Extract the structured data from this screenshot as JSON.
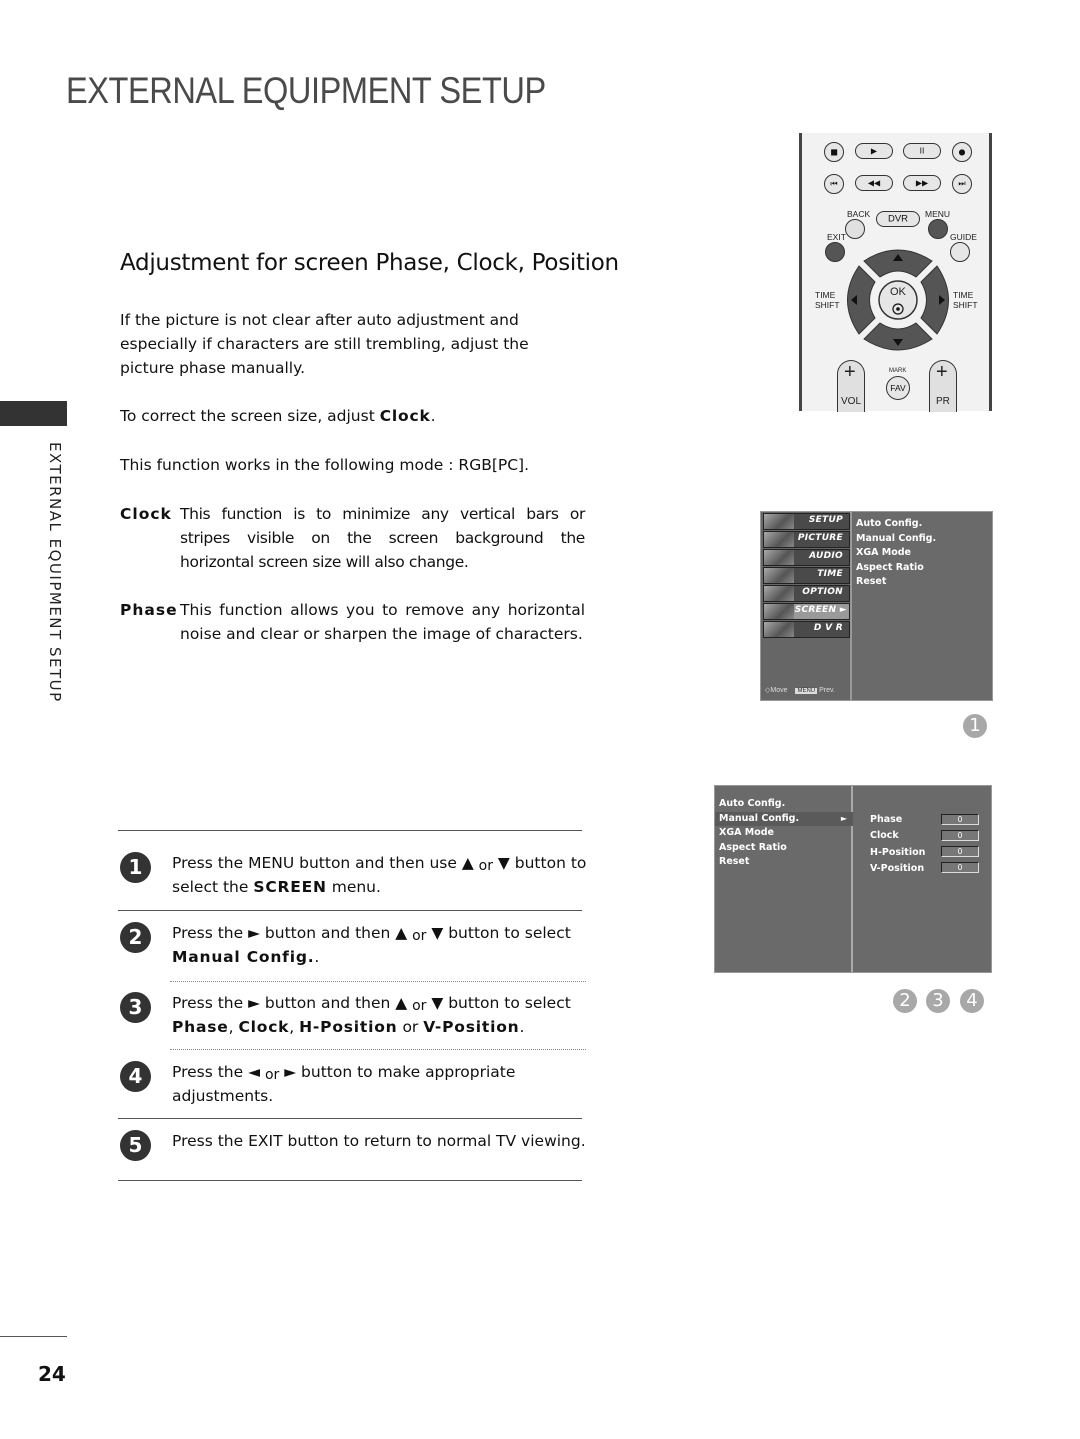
{
  "header": {
    "title": "EXTERNAL EQUIPMENT SETUP"
  },
  "side_label": "EXTERNAL EQUIPMENT SETUP",
  "section": {
    "title": "Adjustment for screen Phase, Clock, Position"
  },
  "intro": {
    "p1": "If the picture is not clear after auto adjustment and especially if characters are still trembling, adjust the picture phase manually.",
    "p2_prefix": "To correct the screen size, adjust ",
    "p2_bold": "Clock",
    "p2_suffix": ".",
    "p3": "This function works in the following mode : RGB[PC]."
  },
  "definitions": [
    {
      "term": "Clock",
      "text": "This function is to minimize any vertical bars or stripes visible on the screen background the horizontal screen size will also change."
    },
    {
      "term": "Phase",
      "text": "This function allows you to remove any horizontal noise and clear or sharpen the image of characters."
    }
  ],
  "steps": [
    {
      "num": "1",
      "a": "Press the ",
      "b1": "MENU",
      "c": " button and then use ▲ ",
      "or": "or",
      "d": " ▼ button to select the ",
      "b2": "SCREEN",
      "e": " menu."
    },
    {
      "num": "2",
      "a": "Press the ► button and then ▲ ",
      "or": "or",
      "d": " ▼ button to select ",
      "b1": "Manual Config.",
      "e": "."
    },
    {
      "num": "3",
      "a": "Press the ► button and then ▲ ",
      "or": "or",
      "d": " ▼ button to select ",
      "b1": "Phase",
      "s1": ", ",
      "b2": "Clock",
      "s2": ", ",
      "b3": "H-Position",
      "s3": " or ",
      "b4": "V-Position",
      "e": "."
    },
    {
      "num": "4",
      "a": "Press the ◄ ",
      "or": "or",
      "d": " ► button to make appropriate adjustments."
    },
    {
      "num": "5",
      "a": "Press the ",
      "b1": "EXIT",
      "e": " button to return to normal TV viewing."
    }
  ],
  "remote": {
    "glyphs": {
      "stop": "■",
      "play": "▶",
      "pause": "II",
      "rec": "●",
      "prev": "⏮",
      "rew": "◀◀",
      "ff": "▶▶",
      "next": "⏭"
    },
    "labels": {
      "back": "BACK",
      "dvr": "DVR",
      "menu": "MENU",
      "exit": "EXIT",
      "guide": "GUIDE",
      "timeshift_l1": "TIME",
      "timeshift_l2": "SHIFT",
      "timeshift_r1": "TIME",
      "timeshift_r2": "SHIFT",
      "ok": "OK",
      "mark": "MARK",
      "fav": "FAV",
      "vol": "VOL",
      "pr": "PR",
      "plus": "+",
      "up": "▲",
      "down": "▼",
      "left": "◀",
      "right": "▶",
      "ok_dot": "⊙"
    }
  },
  "osd1": {
    "menu": [
      {
        "label": "SETUP",
        "active": false
      },
      {
        "label": "PICTURE",
        "active": false
      },
      {
        "label": "AUDIO",
        "active": false
      },
      {
        "label": "TIME",
        "active": false
      },
      {
        "label": "OPTION",
        "active": false
      },
      {
        "label": "SCREEN ►",
        "active": true
      },
      {
        "label": "D V R",
        "active": false
      }
    ],
    "submenu": [
      "Auto Config.",
      "Manual Config.",
      "XGA Mode",
      "Aspect Ratio",
      "Reset"
    ],
    "footer_move": "Move",
    "footer_menu": "MENU",
    "footer_prev": "Prev."
  },
  "osd2": {
    "submenu": [
      "Auto Config.",
      "Manual Config.",
      "XGA Mode",
      "Aspect Ratio",
      "Reset"
    ],
    "selected_arrow": "►",
    "settings": [
      {
        "label": "Phase",
        "value": "0"
      },
      {
        "label": "Clock",
        "value": "0"
      },
      {
        "label": "H-Position",
        "value": "0"
      },
      {
        "label": "V-Position",
        "value": "0"
      }
    ]
  },
  "step_markers": {
    "first": "1",
    "second": "2",
    "third": "3",
    "fourth": "4"
  },
  "page_number": "24"
}
